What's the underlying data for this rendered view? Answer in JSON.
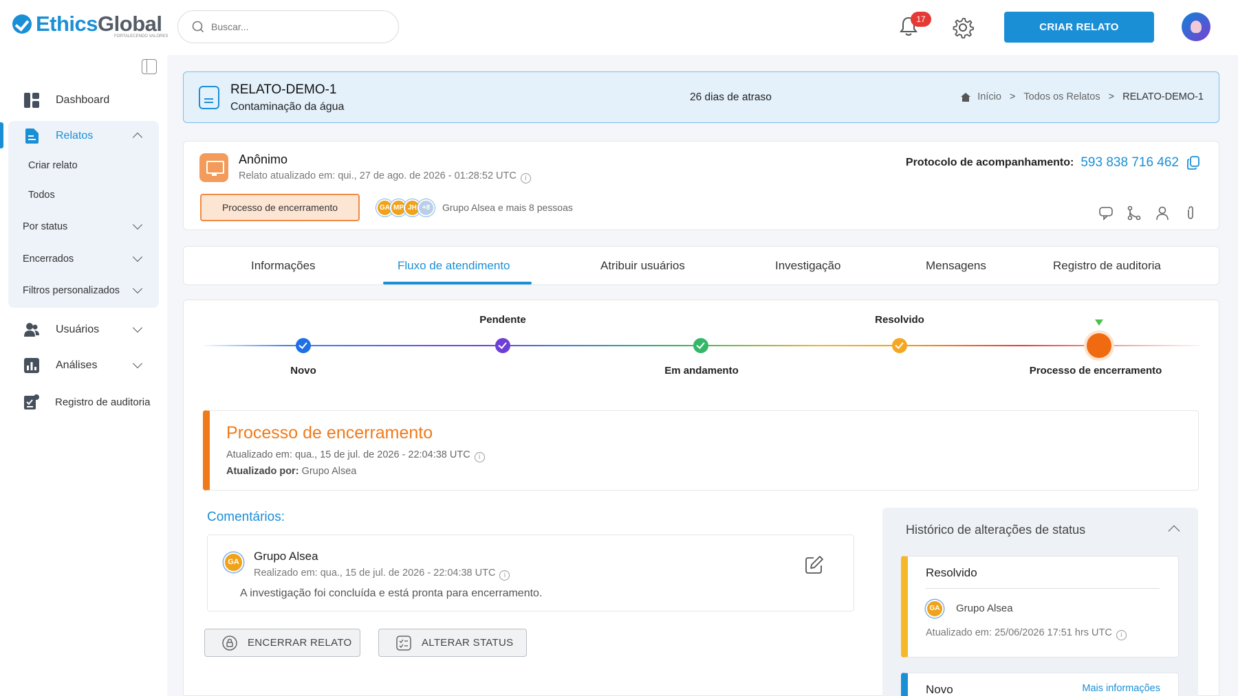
{
  "brand": {
    "name_part1": "Ethics",
    "name_part2": "Global",
    "tagline": "FORTALECENDO VALORES"
  },
  "search": {
    "placeholder": "Buscar..."
  },
  "header": {
    "notifications_count": "17",
    "create_button": "CRIAR RELATO"
  },
  "sidebar": {
    "dashboard": "Dashboard",
    "relatos": "Relatos",
    "relatos_sub": [
      "Criar relato",
      "Todos"
    ],
    "por_status": "Por status",
    "encerrados": "Encerrados",
    "filtros": "Filtros personalizados",
    "usuarios": "Usuários",
    "analises": "Análises",
    "auditoria": "Registro de auditoria"
  },
  "report": {
    "id": "RELATO-DEMO-1",
    "subject": "Contaminação da água",
    "delay": "26 dias de atraso",
    "breadcrumb": [
      "Início",
      "Todos os Relatos",
      "RELATO-DEMO-1"
    ]
  },
  "info": {
    "reporter": "Anônimo",
    "updated": "Relato atualizado em: qui., 27 de ago. de 2026 - 01:28:52 UTC",
    "status": "Processo de encerramento",
    "avatars": [
      "GA",
      "MP",
      "JH",
      "+8"
    ],
    "group_text": "Grupo Alsea e mais 8 pessoas",
    "protocol_label": "Protocolo de acompanhamento:",
    "protocol_number": "593 838 716 462"
  },
  "tabs": [
    "Informações",
    "Fluxo de atendimento",
    "Atribuir usuários",
    "Investigação",
    "Mensagens",
    "Registro de auditoria"
  ],
  "active_tab": "Fluxo de atendimento",
  "workflow": {
    "steps_bottom": [
      "Novo",
      "Em andamento",
      "Processo de encerramento"
    ],
    "steps_top": [
      "Pendente",
      "Resolvido"
    ],
    "current": "Processo de encerramento"
  },
  "current_status": {
    "title": "Processo de encerramento",
    "updated": "Atualizado em: qua., 15 de jul. de 2026 - 22:04:38 UTC",
    "by_label": "Atualizado por:",
    "by_value": "Grupo Alsea"
  },
  "comments": {
    "heading": "Comentários:",
    "items": [
      {
        "initials": "GA",
        "author": "Grupo Alsea",
        "when": "Realizado em: qua., 15 de jul. de 2026 - 22:04:38 UTC",
        "text": "A investigação foi concluída e está pronta para encerramento."
      }
    ]
  },
  "actions": {
    "close": "ENCERRAR RELATO",
    "change_status": "ALTERAR STATUS"
  },
  "history": {
    "title": "Histórico de alterações de status",
    "entries": [
      {
        "status": "Resolvido",
        "initials": "GA",
        "author": "Grupo Alsea",
        "updated": "Atualizado em: 25/06/2026 17:51 hrs UTC"
      },
      {
        "status": "Novo",
        "more": "Mais informações"
      }
    ]
  },
  "colors": {
    "primary": "#1a8fd6",
    "closing": "#f07a1a",
    "resolved": "#f5b82a"
  }
}
